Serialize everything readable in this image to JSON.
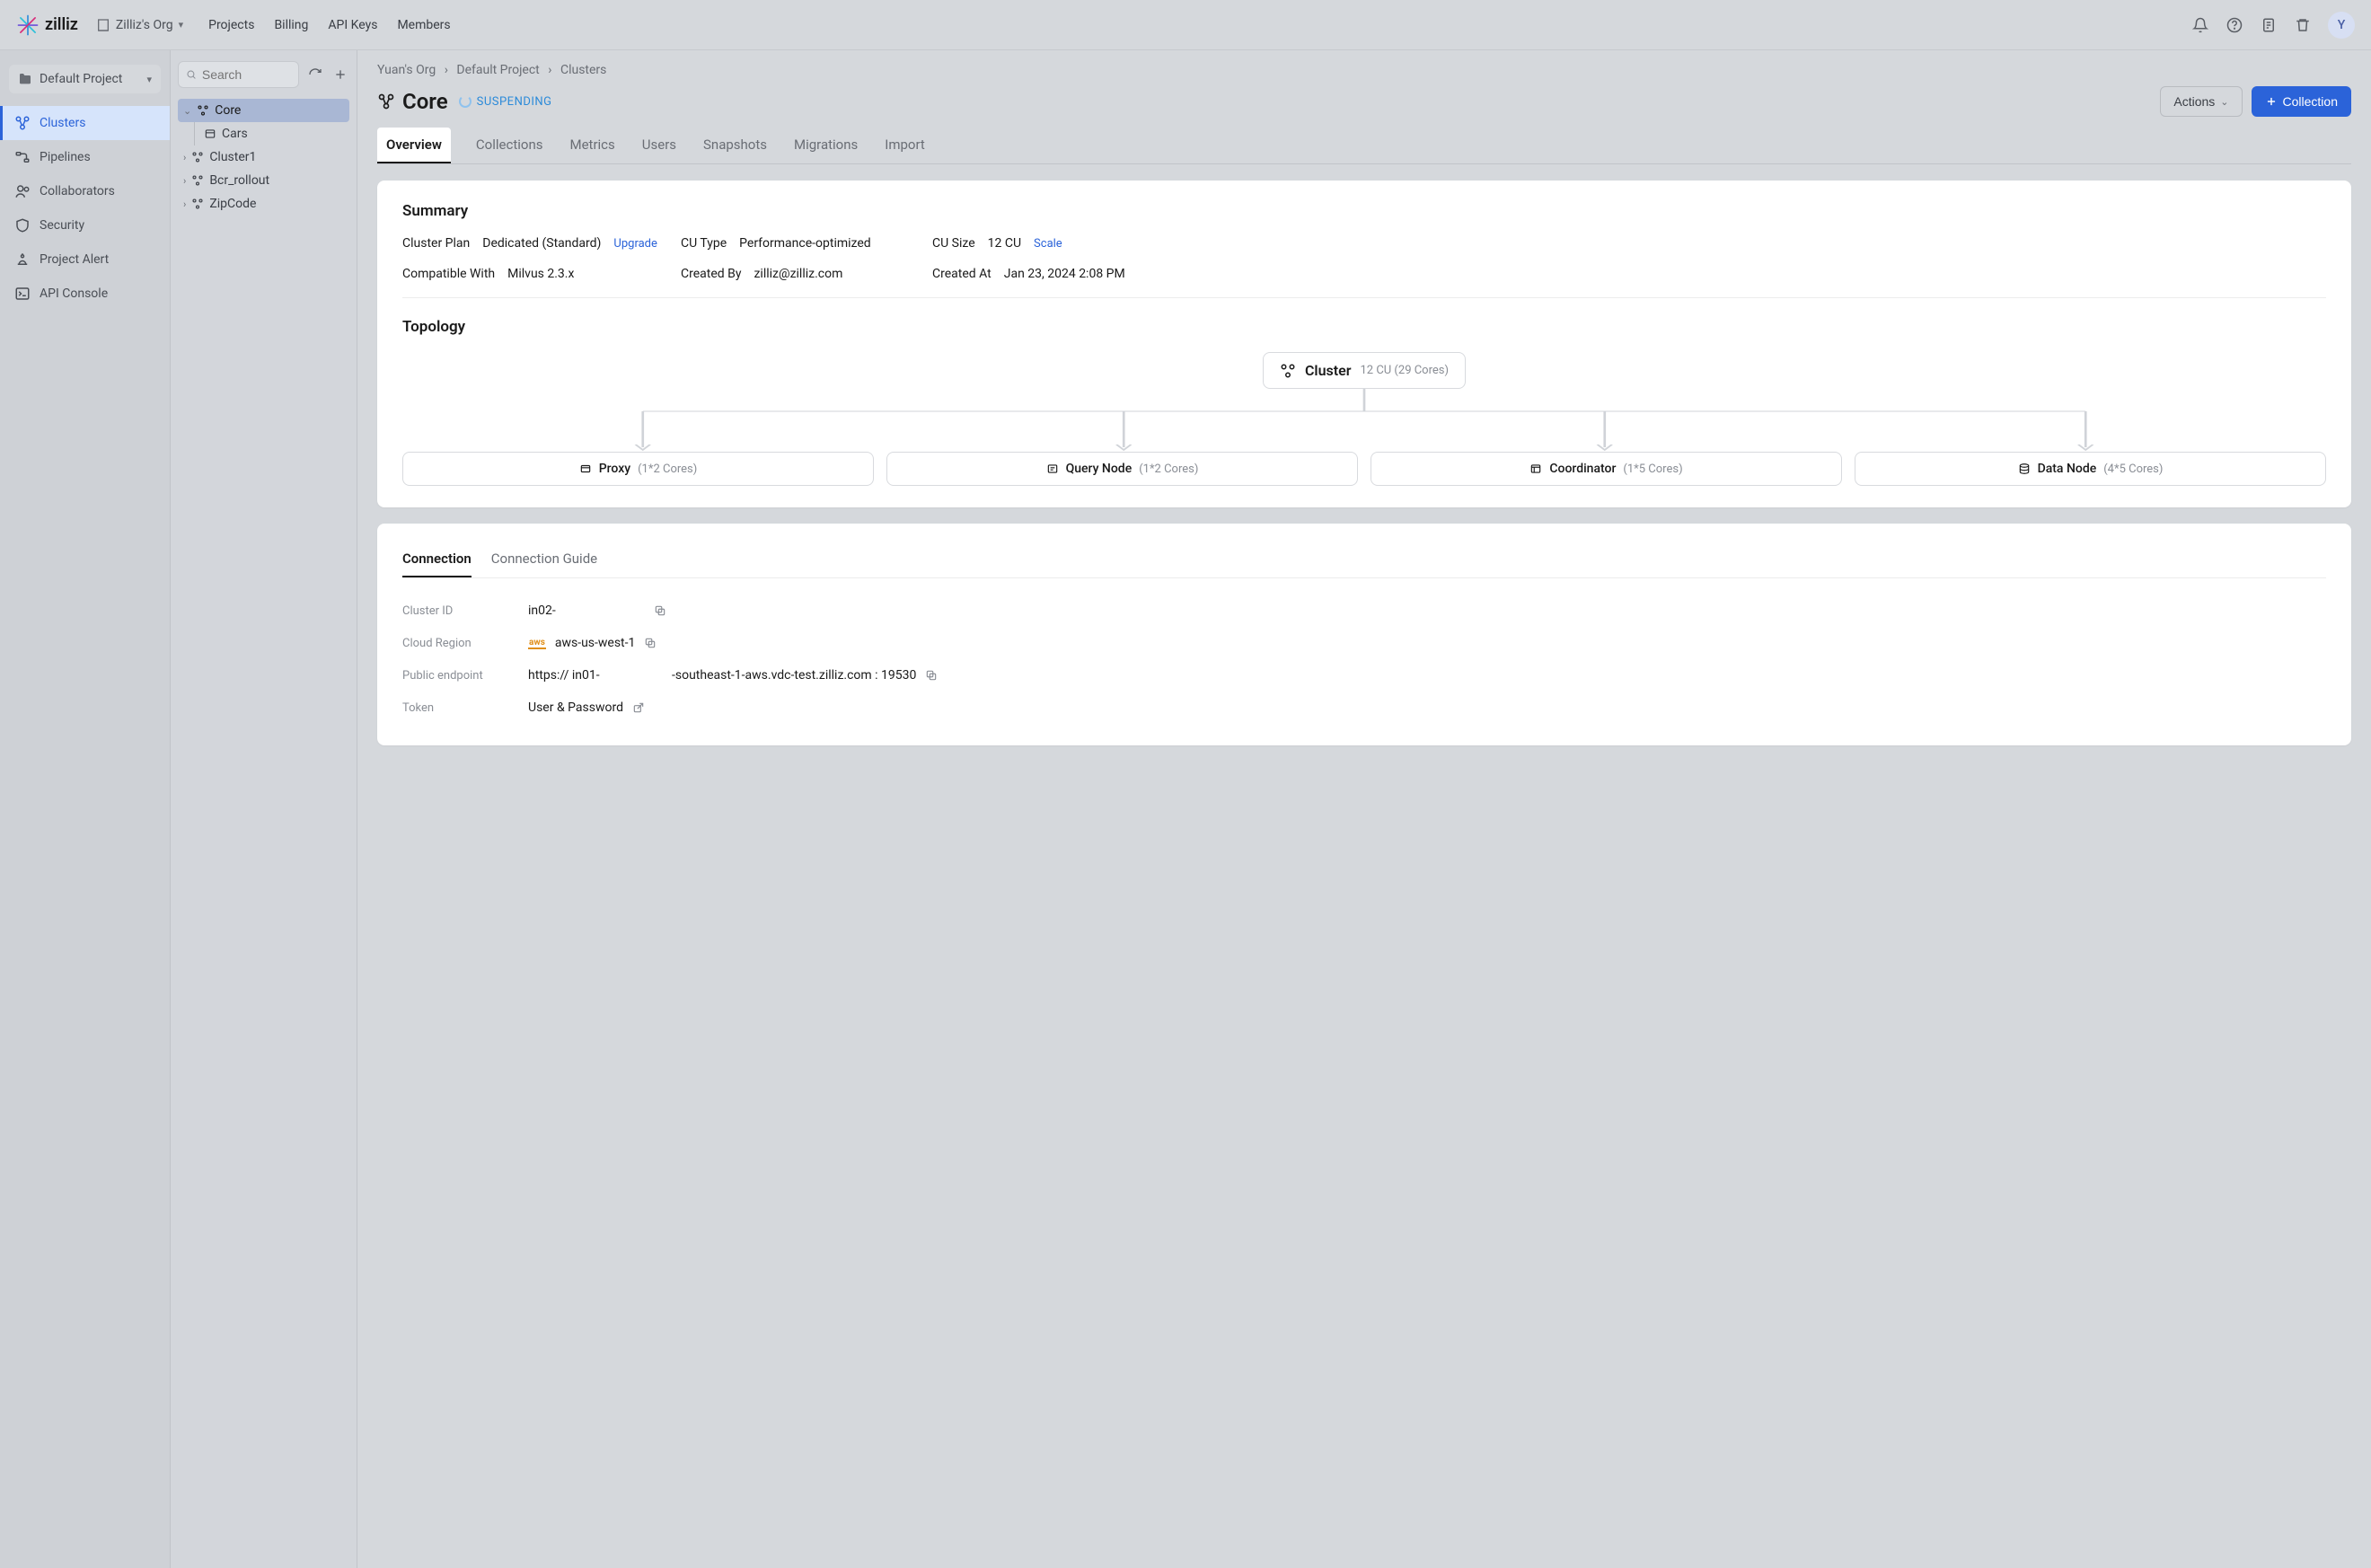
{
  "brand": "zilliz",
  "org_name": "Zilliz's Org",
  "topnav": {
    "projects": "Projects",
    "billing": "Billing",
    "api_keys": "API Keys",
    "members": "Members"
  },
  "avatar_letter": "Y",
  "sidebar": {
    "project": "Default Project",
    "items": [
      {
        "label": "Clusters"
      },
      {
        "label": "Pipelines"
      },
      {
        "label": "Collaborators"
      },
      {
        "label": "Security"
      },
      {
        "label": "Project Alert"
      },
      {
        "label": "API Console"
      }
    ]
  },
  "search_placeholder": "Search",
  "tree": [
    {
      "label": "Core",
      "expanded": true,
      "selected": true,
      "children": [
        {
          "label": "Cars"
        }
      ]
    },
    {
      "label": "Cluster1",
      "expanded": false
    },
    {
      "label": "Bcr_rollout",
      "expanded": false
    },
    {
      "label": "ZipCode",
      "expanded": false
    }
  ],
  "breadcrumb": {
    "a": "Yuan's Org",
    "b": "Default Project",
    "c": "Clusters"
  },
  "cluster_title": "Core",
  "cluster_status": "SUSPENDING",
  "actions_label": "Actions",
  "collection_btn": "Collection",
  "tabs": {
    "overview": "Overview",
    "collections": "Collections",
    "metrics": "Metrics",
    "users": "Users",
    "snapshots": "Snapshots",
    "migrations": "Migrations",
    "import": "Import"
  },
  "summary": {
    "heading": "Summary",
    "plan_label": "Cluster Plan",
    "plan_value": "Dedicated (Standard)",
    "plan_action": "Upgrade",
    "cu_type_label": "CU Type",
    "cu_type_value": "Performance-optimized",
    "cu_size_label": "CU Size",
    "cu_size_value": "12 CU",
    "cu_size_action": "Scale",
    "compat_label": "Compatible With",
    "compat_value": "Milvus 2.3.x",
    "created_by_label": "Created By",
    "created_by_value": "zilliz@zilliz.com",
    "created_at_label": "Created At",
    "created_at_value": "Jan 23, 2024 2:08 PM"
  },
  "topology": {
    "heading": "Topology",
    "root_name": "Cluster",
    "root_meta": "12 CU (29 Cores)",
    "leaves": [
      {
        "name": "Proxy",
        "meta": "(1*2 Cores)"
      },
      {
        "name": "Query Node",
        "meta": "(1*2 Cores)"
      },
      {
        "name": "Coordinator",
        "meta": "(1*5 Cores)"
      },
      {
        "name": "Data Node",
        "meta": "(4*5 Cores)"
      }
    ]
  },
  "connection": {
    "tab1": "Connection",
    "tab2": "Connection Guide",
    "cluster_id_label": "Cluster ID",
    "cluster_id_value": "in02-",
    "region_label": "Cloud Region",
    "region_value": "aws-us-west-1",
    "region_provider": "aws",
    "endpoint_label": "Public endpoint",
    "endpoint_prefix": "https://  in01-",
    "endpoint_suffix": "-southeast-1-aws.vdc-test.zilliz.com  :  19530",
    "token_label": "Token",
    "token_value": "User & Password"
  }
}
